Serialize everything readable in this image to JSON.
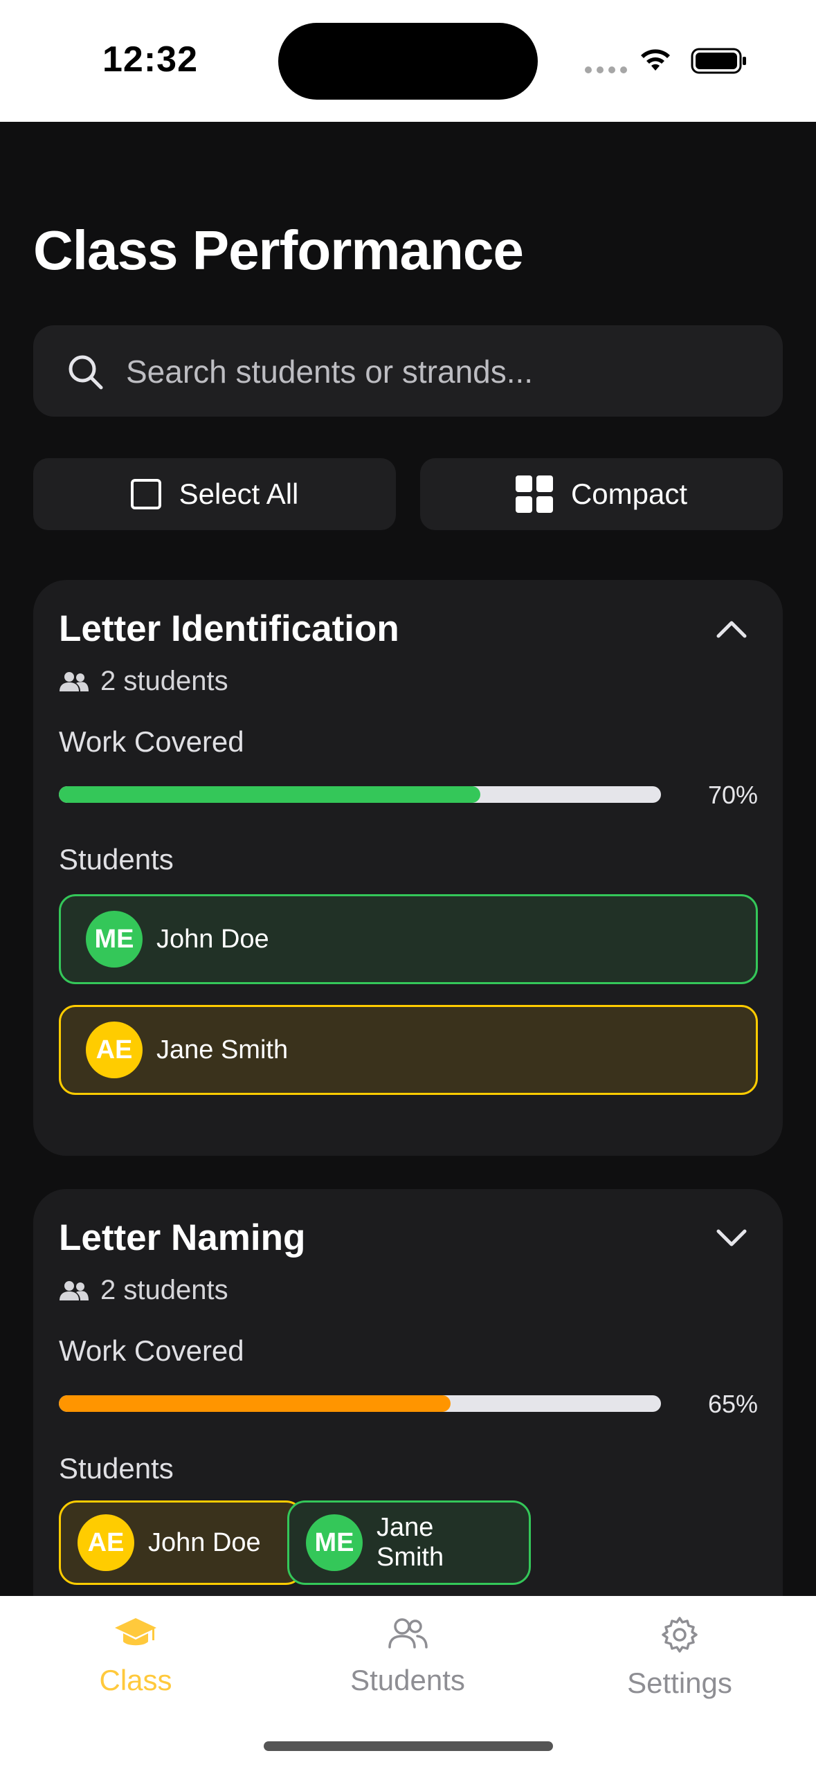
{
  "status": {
    "time": "12:32"
  },
  "page": {
    "title": "Class Performance"
  },
  "search": {
    "placeholder": "Search students or strands..."
  },
  "toolbar": {
    "select_all": "Select All",
    "compact": "Compact"
  },
  "strands": [
    {
      "title": "Letter Identification",
      "expanded": true,
      "students_count": "2 students",
      "work_label": "Work Covered",
      "progress": 0.7,
      "progress_text": "70%",
      "progress_color": "#34c759",
      "students_label": "Students",
      "students": [
        {
          "initials": "ME",
          "name": "John Doe",
          "color": "green"
        },
        {
          "initials": "AE",
          "name": "Jane Smith",
          "color": "yellow"
        }
      ]
    },
    {
      "title": "Letter Naming",
      "expanded": false,
      "students_count": "2 students",
      "work_label": "Work Covered",
      "progress": 0.65,
      "progress_text": "65%",
      "progress_color": "#ff9500",
      "students_label": "Students",
      "students": [
        {
          "initials": "AE",
          "name": "John Doe",
          "color": "yellow"
        },
        {
          "initials": "ME",
          "name": "Jane Smith",
          "color": "green"
        }
      ]
    }
  ],
  "tabs": [
    {
      "label": "Class",
      "icon": "graduation-cap-icon",
      "active": true
    },
    {
      "label": "Students",
      "icon": "people-icon",
      "active": false
    },
    {
      "label": "Settings",
      "icon": "gear-icon",
      "active": false
    }
  ],
  "colors": {
    "accent": "#ffc93c",
    "green": "#34c759",
    "yellow": "#ffcc00",
    "orange": "#ff9500",
    "inactive": "#8e8e93"
  }
}
